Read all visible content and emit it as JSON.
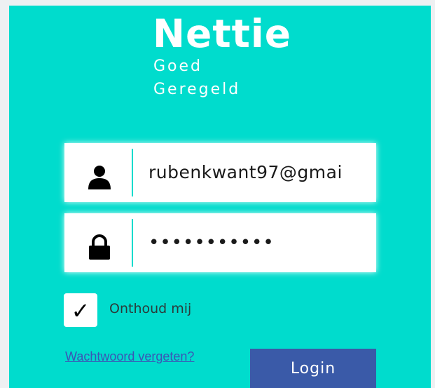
{
  "brand": {
    "name": "Nettie",
    "tagline_line1": "Goed",
    "tagline_line2": "Geregeld"
  },
  "form": {
    "email": {
      "value": "rubenkwant97@gmai",
      "icon": "user-icon"
    },
    "password": {
      "value": "•••••••••••",
      "icon": "lock-icon"
    },
    "remember_me": {
      "checked": true,
      "check_mark": "✓",
      "label": "Onthoud mij"
    },
    "forgot_password_label": "Wachtwoord vergeten?",
    "login_label": "Login"
  },
  "colors": {
    "background": "#00dccd",
    "button": "#3a5aa8",
    "link": "#3b55b5",
    "field": "#ffffff"
  }
}
